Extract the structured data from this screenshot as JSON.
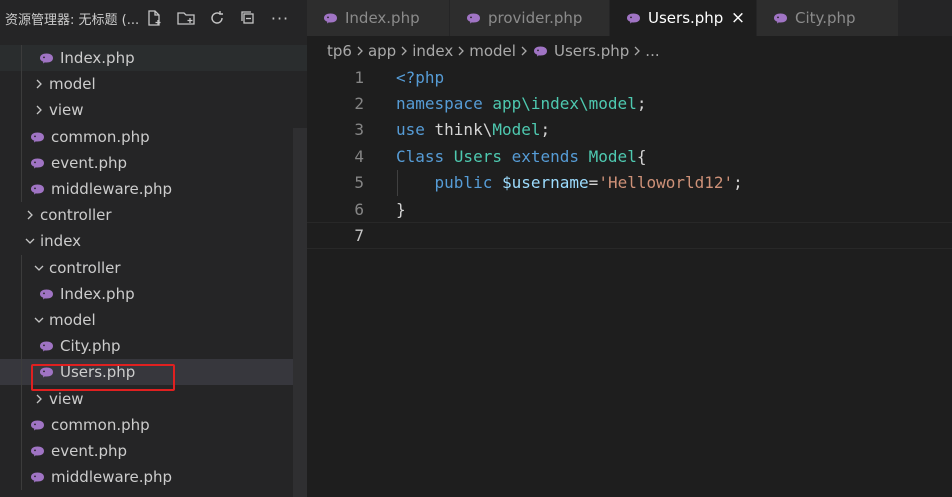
{
  "explorer": {
    "title": "资源管理器: 无标题 (...",
    "actions": {
      "new_file": "new-file-icon",
      "new_folder": "new-folder-icon",
      "refresh": "refresh-icon",
      "collapse": "collapse-all-icon",
      "more": "···"
    },
    "tree": [
      {
        "label": "Index.php",
        "type": "file",
        "depth": 3
      },
      {
        "label": "model",
        "type": "folder",
        "expanded": false,
        "depth": 2
      },
      {
        "label": "view",
        "type": "folder",
        "expanded": false,
        "depth": 2
      },
      {
        "label": "common.php",
        "type": "file",
        "depth": 2
      },
      {
        "label": "event.php",
        "type": "file",
        "depth": 2
      },
      {
        "label": "middleware.php",
        "type": "file",
        "depth": 2
      },
      {
        "label": "controller",
        "type": "folder",
        "expanded": false,
        "depth": 1
      },
      {
        "label": "index",
        "type": "folder",
        "expanded": true,
        "depth": 1
      },
      {
        "label": "controller",
        "type": "folder",
        "expanded": true,
        "depth": 2
      },
      {
        "label": "Index.php",
        "type": "file",
        "depth": 3
      },
      {
        "label": "model",
        "type": "folder",
        "expanded": true,
        "depth": 2
      },
      {
        "label": "City.php",
        "type": "file",
        "depth": 3
      },
      {
        "label": "Users.php",
        "type": "file",
        "depth": 3,
        "selected": true
      },
      {
        "label": "view",
        "type": "folder",
        "expanded": false,
        "depth": 2
      },
      {
        "label": "common.php",
        "type": "file",
        "depth": 2
      },
      {
        "label": "event.php",
        "type": "file",
        "depth": 2
      },
      {
        "label": "middleware.php",
        "type": "file",
        "depth": 2
      }
    ]
  },
  "tabs": [
    {
      "label": "Index.php",
      "active": false
    },
    {
      "label": "provider.php",
      "active": false
    },
    {
      "label": "Users.php",
      "active": true,
      "close": "×"
    },
    {
      "label": "City.php",
      "active": false
    }
  ],
  "breadcrumb": {
    "parts": [
      "tp6",
      "app",
      "index",
      "model"
    ],
    "file": "Users.php",
    "more": "..."
  },
  "code": {
    "current_line": 7,
    "lines": [
      {
        "no": "1",
        "tokens": [
          {
            "t": "<?php",
            "c": "kw"
          }
        ]
      },
      {
        "no": "2",
        "tokens": [
          {
            "t": "namespace ",
            "c": "kw"
          },
          {
            "t": "app\\index\\model",
            "c": "ns"
          },
          {
            "t": ";",
            "c": "plain"
          }
        ]
      },
      {
        "no": "3",
        "tokens": [
          {
            "t": "use ",
            "c": "kw"
          },
          {
            "t": "think",
            "c": "plain"
          },
          {
            "t": "\\",
            "c": "plain"
          },
          {
            "t": "Model",
            "c": "cls"
          },
          {
            "t": ";",
            "c": "plain"
          }
        ]
      },
      {
        "no": "4",
        "tokens": [
          {
            "t": "Class ",
            "c": "kw"
          },
          {
            "t": "Users ",
            "c": "cls"
          },
          {
            "t": "extends ",
            "c": "kw"
          },
          {
            "t": "Model",
            "c": "cls"
          },
          {
            "t": "{",
            "c": "plain"
          }
        ]
      },
      {
        "no": "5",
        "tokens": [
          {
            "t": "    public ",
            "c": "kw"
          },
          {
            "t": "$username",
            "c": "var"
          },
          {
            "t": "=",
            "c": "plain"
          },
          {
            "t": "'Helloworld12'",
            "c": "str"
          },
          {
            "t": ";",
            "c": "plain"
          }
        ]
      },
      {
        "no": "6",
        "tokens": [
          {
            "t": "}",
            "c": "plain"
          }
        ]
      },
      {
        "no": "7",
        "tokens": []
      }
    ]
  },
  "colors": {
    "php_icon": "#a074c4",
    "highlight_box": "#e02020"
  }
}
